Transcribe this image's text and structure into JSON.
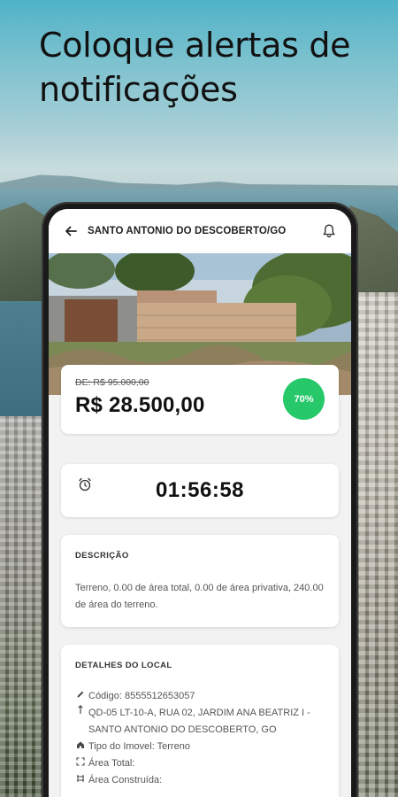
{
  "headline": "Coloque alertas de notificações",
  "appbar": {
    "title": "SANTO ANTONIO DO DESCOBERTO/GO",
    "back_icon": "arrow-left-icon",
    "bell_icon": "bell-icon"
  },
  "price": {
    "old": "DE: R$ 95.000,00",
    "current": "R$ 28.500,00",
    "discount": "70%"
  },
  "timer": {
    "icon": "alarm-clock-icon",
    "value": "01:56:58"
  },
  "description": {
    "title": "DESCRIÇÃO",
    "text": "Terreno, 0.00 de área total, 0.00 de área privativa, 240.00 de área do terreno."
  },
  "details": {
    "title": "DETALHES DO LOCAL",
    "items": [
      {
        "icon": "pencil-icon",
        "text": "Código: 8555512653057"
      },
      {
        "icon": "location-pin-icon",
        "text": "QD-05 LT-10-A, RUA 02, JARDIM ANA BEATRIZ I - SANTO ANTONIO DO DESCOBERTO, GO"
      },
      {
        "icon": "home-icon",
        "text": "Tipo do Imovel: Terreno"
      },
      {
        "icon": "expand-icon",
        "text": "Área Total:"
      },
      {
        "icon": "area-icon",
        "text": "Área Construída:"
      }
    ]
  },
  "colors": {
    "discount_badge": "#26c86a",
    "background_sky": "#4fb3c7"
  }
}
